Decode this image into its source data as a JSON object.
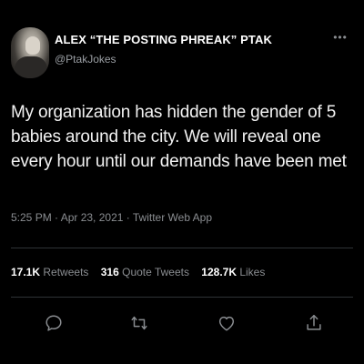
{
  "tweet": {
    "author": {
      "display_name": "ALEX “THE POSTING PHREAK” PTAK",
      "handle": "@PtakJokes",
      "avatar_icon": "profile-photo"
    },
    "text": "My organization has hidden the gender of 5 babies around the city.  We will reveal one every hour until our demands have been met",
    "timestamp": "5:25 PM · Apr 23, 2021 · Twitter Web App",
    "stats": {
      "retweets": {
        "count": "17.1K",
        "label": "Retweets"
      },
      "quote_tweets": {
        "count": "316",
        "label": "Quote Tweets"
      },
      "likes": {
        "count": "128.7K",
        "label": "Likes"
      }
    },
    "actions": [
      {
        "name": "reply",
        "icon": "reply-icon"
      },
      {
        "name": "retweet",
        "icon": "retweet-icon"
      },
      {
        "name": "like",
        "icon": "heart-icon"
      },
      {
        "name": "share",
        "icon": "share-icon"
      }
    ],
    "more_icon": "more-options-icon"
  },
  "colors": {
    "background": "#000000",
    "text_primary": "#ffffff",
    "text_secondary": "#8a8d91",
    "divider": "#2f3336"
  }
}
